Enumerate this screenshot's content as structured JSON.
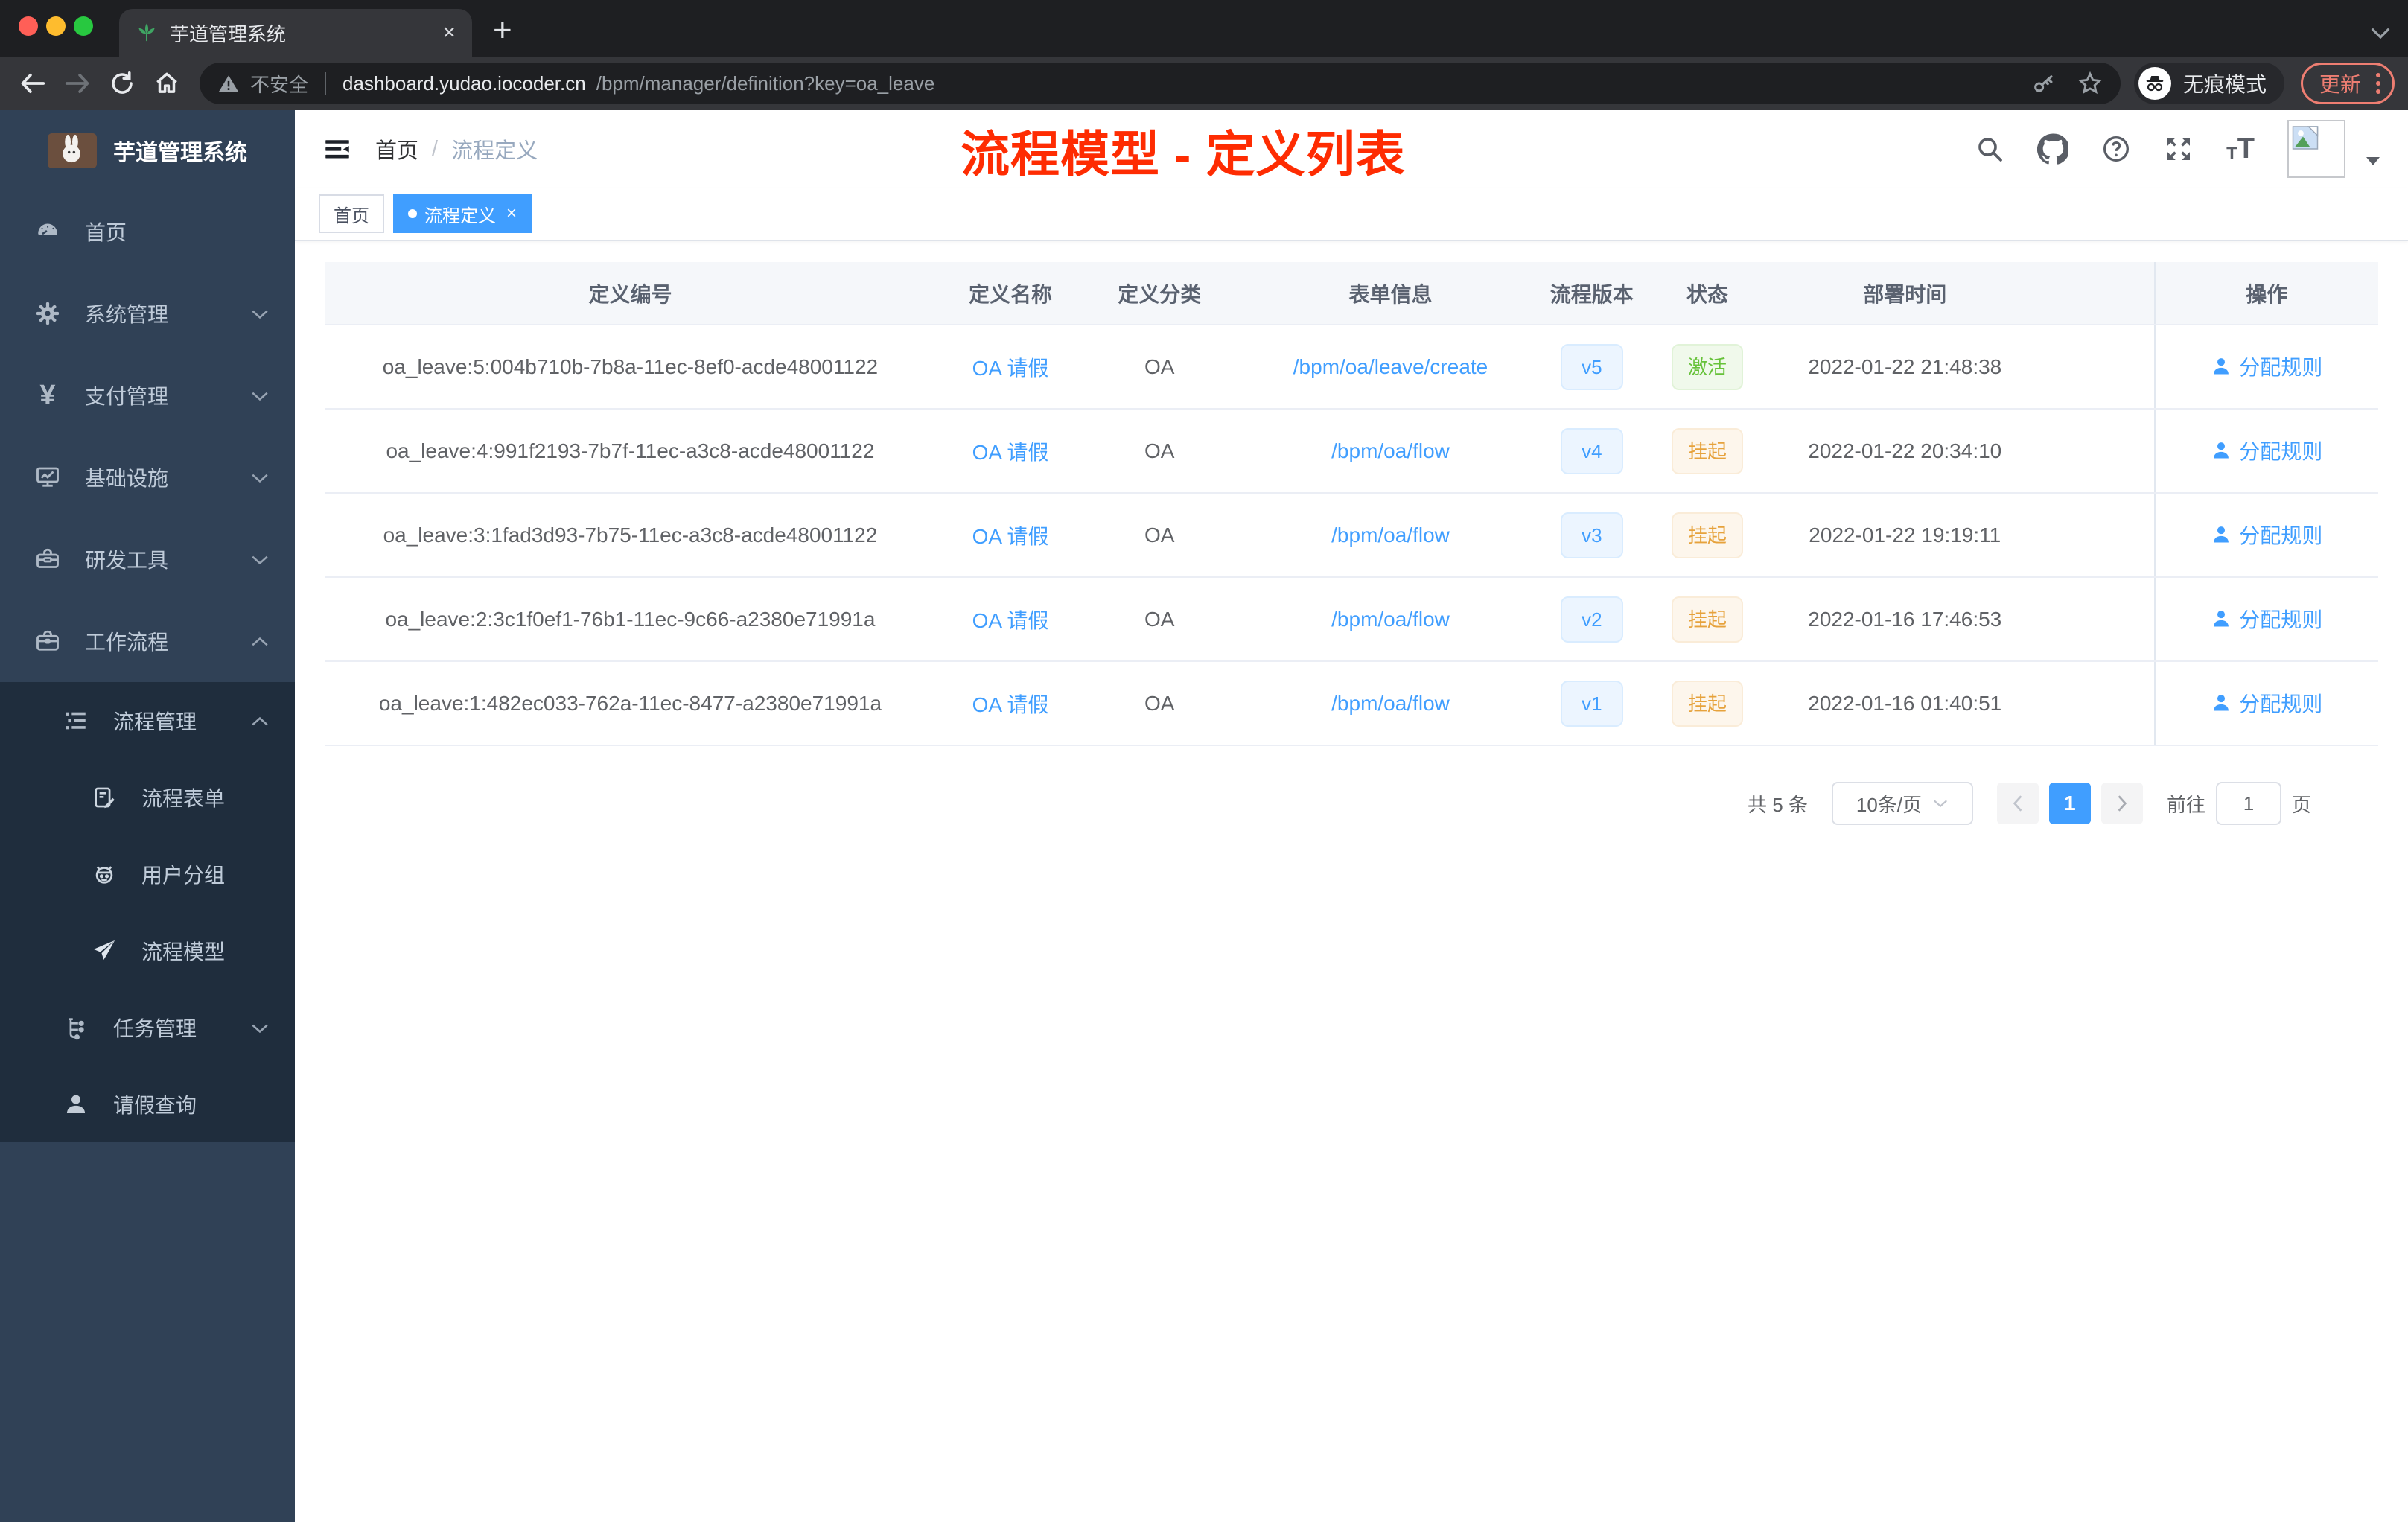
{
  "browser": {
    "tab_title": "芋道管理系统",
    "new_tab": "+",
    "security_label": "不安全",
    "url_host": "dashboard.yudao.iocoder.cn",
    "url_path": "/bpm/manager/definition?key=oa_leave",
    "incognito_label": "无痕模式",
    "update_label": "更新"
  },
  "sidebar": {
    "app_title": "芋道管理系统",
    "items": [
      {
        "label": "首页",
        "icon": "dashboard-icon"
      },
      {
        "label": "系统管理",
        "icon": "gear-icon",
        "expandable": true
      },
      {
        "label": "支付管理",
        "icon": "yen-icon",
        "expandable": true
      },
      {
        "label": "基础设施",
        "icon": "monitor-icon",
        "expandable": true
      },
      {
        "label": "研发工具",
        "icon": "toolbox-icon",
        "expandable": true
      },
      {
        "label": "工作流程",
        "icon": "briefcase-icon",
        "expandable": true,
        "expanded": true
      }
    ],
    "workflow_children": [
      {
        "label": "流程管理",
        "icon": "list-icon",
        "expanded": true
      },
      {
        "label": "流程表单",
        "icon": "form-icon"
      },
      {
        "label": "用户分组",
        "icon": "robot-icon"
      },
      {
        "label": "流程模型",
        "icon": "paper-plane-icon"
      },
      {
        "label": "任务管理",
        "icon": "tree-icon",
        "expandable": true
      },
      {
        "label": "请假查询",
        "icon": "person-icon"
      }
    ]
  },
  "header": {
    "breadcrumb_home": "首页",
    "breadcrumb_separator": "/",
    "breadcrumb_current": "流程定义",
    "annotation": "流程模型 - 定义列表"
  },
  "tags": {
    "home": "首页",
    "active": "流程定义",
    "close": "×"
  },
  "table": {
    "columns": [
      "定义编号",
      "定义名称",
      "定义分类",
      "表单信息",
      "流程版本",
      "状态",
      "部署时间",
      "操作"
    ],
    "action_label": "分配规则",
    "rows": [
      {
        "id": "oa_leave:5:004b710b-7b8a-11ec-8ef0-acde48001122",
        "name": "OA 请假",
        "category": "OA",
        "form": "/bpm/oa/leave/create",
        "version": "v5",
        "status": "激活",
        "status_type": "success",
        "deploy_time": "2022-01-22 21:48:38",
        "action": "分配规则"
      },
      {
        "id": "oa_leave:4:991f2193-7b7f-11ec-a3c8-acde48001122",
        "name": "OA 请假",
        "category": "OA",
        "form": "/bpm/oa/flow",
        "version": "v4",
        "status": "挂起",
        "status_type": "warning",
        "deploy_time": "2022-01-22 20:34:10",
        "action": "分配规则"
      },
      {
        "id": "oa_leave:3:1fad3d93-7b75-11ec-a3c8-acde48001122",
        "name": "OA 请假",
        "category": "OA",
        "form": "/bpm/oa/flow",
        "version": "v3",
        "status": "挂起",
        "status_type": "warning",
        "deploy_time": "2022-01-22 19:19:11",
        "action": "分配规则"
      },
      {
        "id": "oa_leave:2:3c1f0ef1-76b1-11ec-9c66-a2380e71991a",
        "name": "OA 请假",
        "category": "OA",
        "form": "/bpm/oa/flow",
        "version": "v2",
        "status": "挂起",
        "status_type": "warning",
        "deploy_time": "2022-01-16 17:46:53",
        "action": "分配规则"
      },
      {
        "id": "oa_leave:1:482ec033-762a-11ec-8477-a2380e71991a",
        "name": "OA 请假",
        "category": "OA",
        "form": "/bpm/oa/flow",
        "version": "v1",
        "status": "挂起",
        "status_type": "warning",
        "deploy_time": "2022-01-16 01:40:51",
        "action": "分配规则"
      }
    ]
  },
  "pagination": {
    "total_label": "共 5 条",
    "page_size": "10条/页",
    "current_page": "1",
    "goto_label": "前往",
    "goto_value": "1",
    "page_unit": "页"
  },
  "colors": {
    "accent": "#409eff",
    "annotation_red": "#fe2c02",
    "success_text": "#67c23a",
    "success_bg": "#f0f9eb",
    "warning_text": "#e6a23c",
    "warning_bg": "#fdf6ec",
    "version_bg": "#ecf5ff",
    "sidebar_bg": "#304156",
    "sidebar_nested_bg": "#1f2d3d",
    "chrome_dark": "#1e1f22",
    "chrome_toolbar": "#35363a",
    "update_red": "#ee7e72"
  }
}
